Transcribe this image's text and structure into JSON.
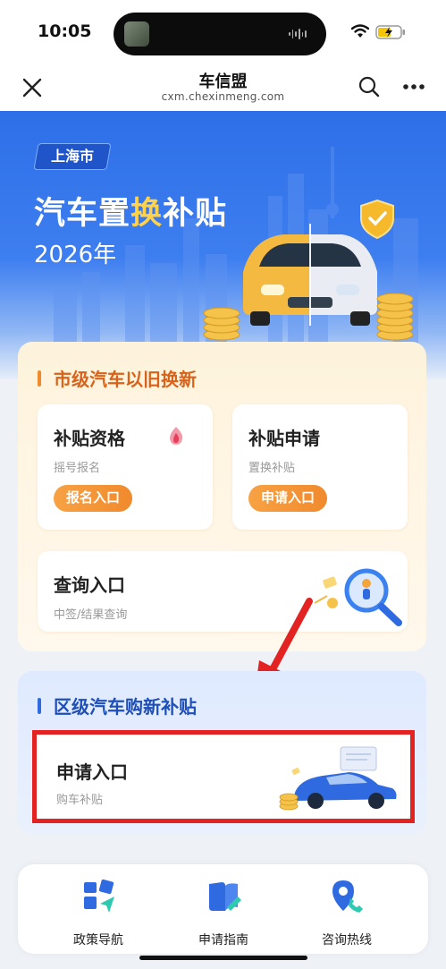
{
  "status_bar": {
    "time": "10:05"
  },
  "nav": {
    "title": "车信盟",
    "domain": "cxm.chexinmeng.com"
  },
  "hero": {
    "city_tag": "上海市",
    "title_part1": "汽车置",
    "title_highlight": "换",
    "title_part2": "补贴",
    "year": "2026年"
  },
  "city_section": {
    "title": "市级汽车以旧换新",
    "accent_color": "#f08a2d",
    "cards": [
      {
        "title": "补贴资格",
        "subtitle": "摇号报名",
        "button": "报名入口"
      },
      {
        "title": "补贴申请",
        "subtitle": "置换补贴",
        "button": "申请入口"
      }
    ],
    "query": {
      "title": "查询入口",
      "subtitle": "中签/结果查询"
    }
  },
  "district_section": {
    "title": "区级汽车购新补贴",
    "accent_color": "#2f6ae0",
    "apply": {
      "title": "申请入口",
      "subtitle": "购车补贴"
    },
    "highlight_color": "#e32222"
  },
  "bottom_nav": [
    {
      "label": "政策导航",
      "icon": "policy-nav-icon"
    },
    {
      "label": "申请指南",
      "icon": "guide-icon"
    },
    {
      "label": "咨询热线",
      "icon": "hotline-icon"
    }
  ]
}
